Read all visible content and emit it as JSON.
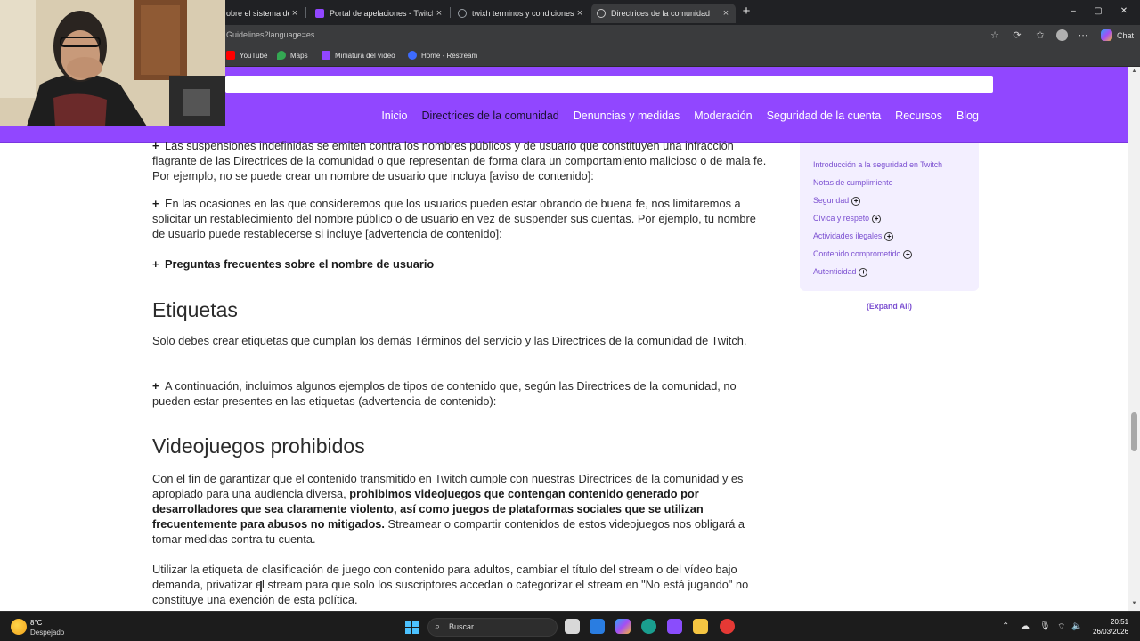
{
  "browser": {
    "tabs": [
      {
        "title": "obre el sistema de ap",
        "favicon_color": "#4285f4",
        "active": false
      },
      {
        "title": "Portal de apelaciones - Twitch",
        "favicon_color": "#9146ff",
        "active": false
      },
      {
        "title": "twixh terminos y condiciones - Co",
        "favicon_color": "#5f6368",
        "active": false
      },
      {
        "title": "Directrices de la comunidad",
        "favicon_color": "#5f6368",
        "active": true
      }
    ],
    "close_glyph": "×",
    "new_tab_glyph": "+",
    "window_controls": {
      "minimize": "–",
      "maximize": "▢",
      "close": "✕"
    },
    "url": "Guidelines?language=es",
    "copilot_label": "Chat",
    "bookmarks": [
      {
        "label": "YouTube",
        "icon_color": "#ff0000"
      },
      {
        "label": "Maps",
        "icon_color": "#34a853"
      },
      {
        "label": "Miniatura del vídeo",
        "icon_color": "#9146ff"
      },
      {
        "label": "Home - Restream",
        "icon_color": "#3d6bff"
      }
    ]
  },
  "site": {
    "accent": "#9147ff",
    "nav": {
      "items": [
        "Inicio",
        "Directrices de la comunidad",
        "Denuncias y medidas",
        "Moderación",
        "Seguridad de la cuenta",
        "Recursos",
        "Blog"
      ],
      "active_index": 1
    }
  },
  "article": {
    "p1": "Las suspensiones indefinidas se emiten contra los nombres públicos y de usuario que constituyen una infracción flagrante de las Directrices de la comunidad o que representan de forma clara un comportamiento malicioso o de mala fe. Por ejemplo, no se puede crear un nombre de usuario que incluya [aviso de contenido]:",
    "p2": "En las ocasiones en las que consideremos que los usuarios pueden estar obrando de buena fe, nos limitaremos a solicitar un restablecimiento del nombre público o de usuario en vez de suspender sus cuentas. Por ejemplo, tu nombre de usuario puede restablecerse si incluye [advertencia de contenido]:",
    "faq": "Preguntas frecuentes sobre el nombre de usuario",
    "h_etiquetas": "Etiquetas",
    "p3": "Solo debes crear etiquetas que cumplan los demás Términos del servicio y las Directrices de la comunidad de Twitch.",
    "p4": "A continuación, incluimos algunos ejemplos de tipos de contenido que, según las Directrices de la comunidad, no pueden estar presentes en las etiquetas (advertencia de contenido):",
    "h_videojuegos": "Videojuegos prohibidos",
    "p5_a": "Con el fin de garantizar que el contenido transmitido en Twitch cumple con nuestras Directrices de la comunidad y es apropiado para una audiencia diversa, ",
    "p5_b": "prohibimos videojuegos que contengan contenido generado por desarrolladores que sea claramente violento, así como juegos de plataformas sociales que se utilizan frecuentemente para abusos no mitigados.",
    "p5_c": " Streamear o compartir contenidos de estos videojuegos nos obligará a tomar medidas contra tu cuenta.",
    "p6": "Utilizar la etiqueta de clasificación de juego con contenido para adultos, cambiar el título del stream o del vídeo bajo demanda, privatizar el stream para que solo los suscriptores accedan o categorizar el stream en \"No está jugando\" no constituye una exención de esta política.",
    "expand_glyph": "+"
  },
  "sidebar": {
    "links": [
      {
        "label": "Introducción a la seguridad en Twitch",
        "expandable": false
      },
      {
        "label": "Notas de cumplimiento",
        "expandable": false
      },
      {
        "label": "Seguridad",
        "expandable": true
      },
      {
        "label": "Cívica y respeto",
        "expandable": true
      },
      {
        "label": "Actividades ilegales",
        "expandable": true
      },
      {
        "label": "Contenido comprometido",
        "expandable": true
      },
      {
        "label": "Autenticidad",
        "expandable": true
      }
    ],
    "expand_all": "(Expand All)"
  },
  "taskbar": {
    "weather_temp": "8°C",
    "weather_desc": "Despejado",
    "search_placeholder": "Buscar",
    "time": "20:51",
    "date": "26/03/2026"
  }
}
